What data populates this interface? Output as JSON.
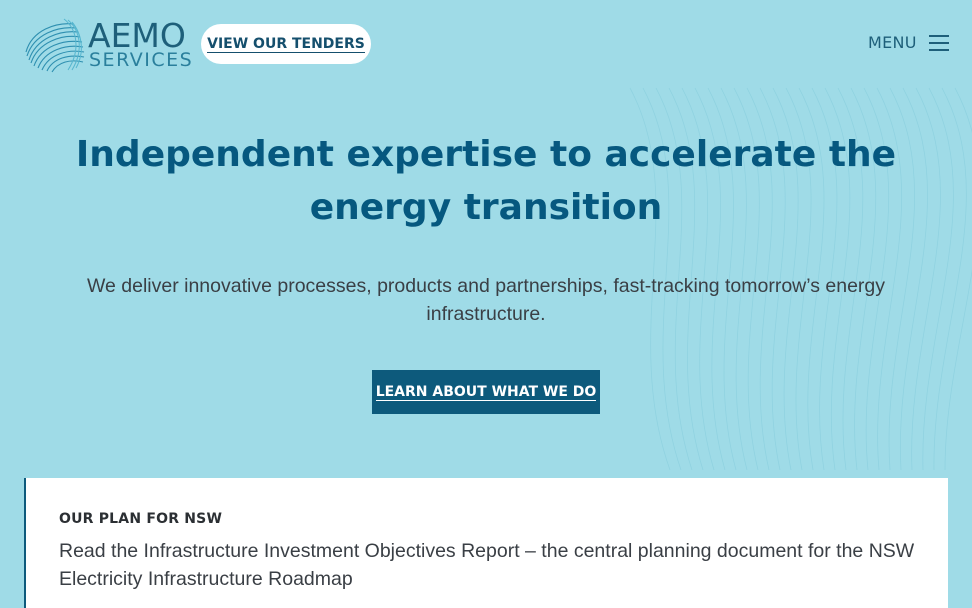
{
  "brand": {
    "name_main": "AEMO",
    "name_sub": "SERVICES"
  },
  "header": {
    "tenders_label": "VIEW OUR TENDERS",
    "menu_label": "MENU"
  },
  "hero": {
    "title": "Independent expertise to accelerate the energy transition",
    "description": "We deliver innovative processes, products and partnerships, fast-tracking tomorrow’s energy infrastructure.",
    "cta_label": "LEARN ABOUT WHAT WE DO"
  },
  "feature_card": {
    "eyebrow": "OUR PLAN FOR NSW",
    "text": "Read the Infrastructure Investment Objectives Report – the central planning document for the NSW Electricity Infrastructure Roadmap"
  },
  "colors": {
    "background": "#9fdbe7",
    "primary": "#0d5a7c",
    "heading": "#06587f",
    "body_text": "#3a3f45",
    "white": "#ffffff"
  },
  "icons": {
    "logo_mark": "aemo-swirl-icon",
    "menu": "hamburger-menu-icon"
  }
}
